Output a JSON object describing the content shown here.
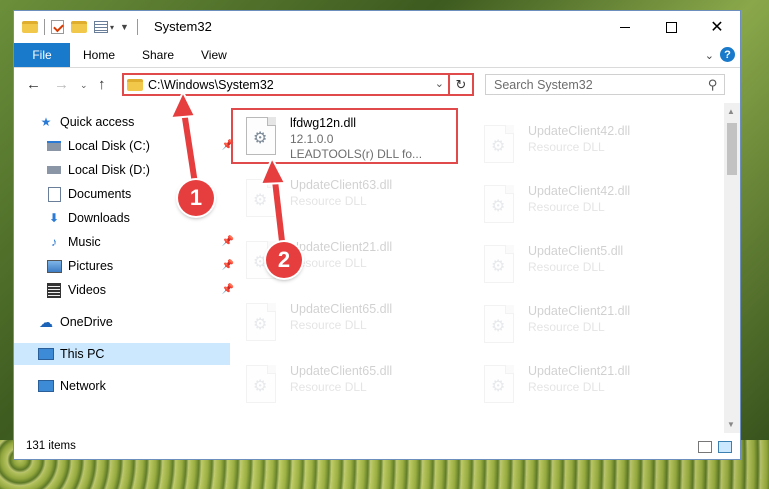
{
  "window": {
    "title": "System32"
  },
  "ribbon": {
    "file": "File",
    "home": "Home",
    "share": "Share",
    "view": "View",
    "help": "?"
  },
  "address": {
    "path": "C:\\Windows\\System32"
  },
  "search": {
    "placeholder": "Search System32"
  },
  "sidebar": {
    "items": [
      {
        "label": "Quick access",
        "icon": "star-icon"
      },
      {
        "label": "Local Disk (C:)",
        "icon": "drive-icon"
      },
      {
        "label": "Local Disk (D:)",
        "icon": "drive-icon"
      },
      {
        "label": "Documents",
        "icon": "documents-icon"
      },
      {
        "label": "Downloads",
        "icon": "download-icon"
      },
      {
        "label": "Music",
        "icon": "music-icon"
      },
      {
        "label": "Pictures",
        "icon": "pictures-icon"
      },
      {
        "label": "Videos",
        "icon": "videos-icon"
      },
      {
        "label": "OneDrive",
        "icon": "cloud-icon"
      },
      {
        "label": "This PC",
        "icon": "computer-icon"
      },
      {
        "label": "Network",
        "icon": "network-icon"
      }
    ]
  },
  "files": {
    "highlighted": {
      "name": "lfdwg12n.dll",
      "version": "12.1.0.0",
      "desc": "LEADTOOLS(r) DLL fo..."
    },
    "left": [
      {
        "name": "UpdateClient63.dll",
        "desc": "Resource DLL"
      },
      {
        "name": "UpdateClient21.dll",
        "desc": "Resource DLL"
      },
      {
        "name": "UpdateClient65.dll",
        "desc": "Resource DLL"
      },
      {
        "name": "UpdateClient65.dll",
        "desc": "Resource DLL"
      }
    ],
    "right": [
      {
        "name": "UpdateClient42.dll",
        "desc": "Resource DLL"
      },
      {
        "name": "UpdateClient42.dll",
        "desc": "Resource DLL"
      },
      {
        "name": "UpdateClient5.dll",
        "desc": "Resource DLL"
      },
      {
        "name": "UpdateClient21.dll",
        "desc": "Resource DLL"
      },
      {
        "name": "UpdateClient21.dll",
        "desc": "Resource DLL"
      }
    ]
  },
  "status": {
    "count": "131 items"
  },
  "callouts": {
    "one": "1",
    "two": "2"
  },
  "colors": {
    "accent": "#1979ca",
    "highlight": "#e04a4a",
    "selected": "#cce8ff"
  }
}
